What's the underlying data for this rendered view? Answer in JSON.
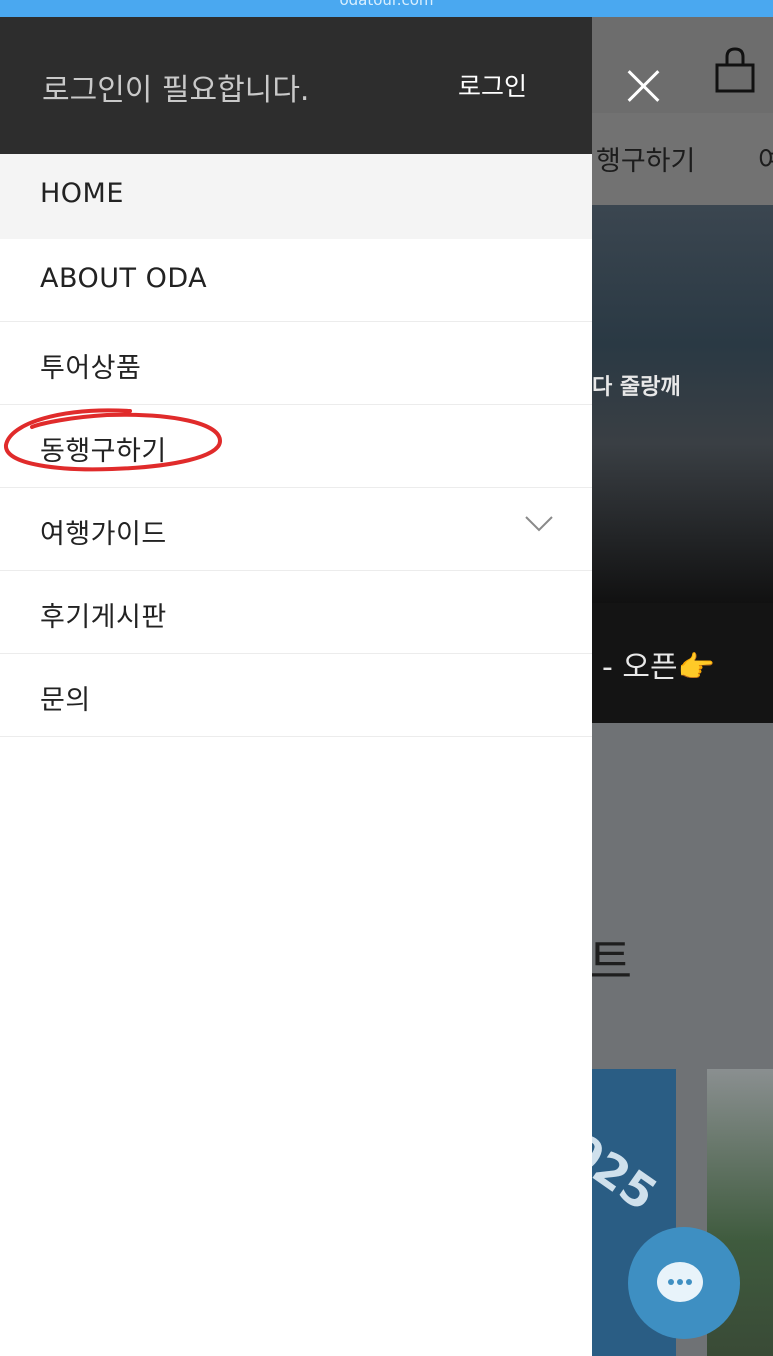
{
  "browser": {
    "url_text": "odatour.com"
  },
  "drawer": {
    "login_message": "로그인이 필요합니다.",
    "login_button": "로그인",
    "menu": [
      {
        "label": "HOME",
        "active": true
      },
      {
        "label": "ABOUT ODA"
      },
      {
        "label": "투어상품"
      },
      {
        "label": "동행구하기",
        "circled": true
      },
      {
        "label": "여행가이드",
        "has_submenu": true
      },
      {
        "label": "후기게시판"
      },
      {
        "label": "문의"
      }
    ]
  },
  "background_page": {
    "tab_partial": "행구하기",
    "tab_partial2": "여",
    "banner_text": "다 줄랑깨",
    "open_text": "- 오픈👉",
    "section_char": "트",
    "card_text": "025"
  },
  "colors": {
    "drawer_header": "#2d2d2d",
    "highlight_circle": "#e02b2b",
    "chat_button": "#3e8fc2"
  }
}
